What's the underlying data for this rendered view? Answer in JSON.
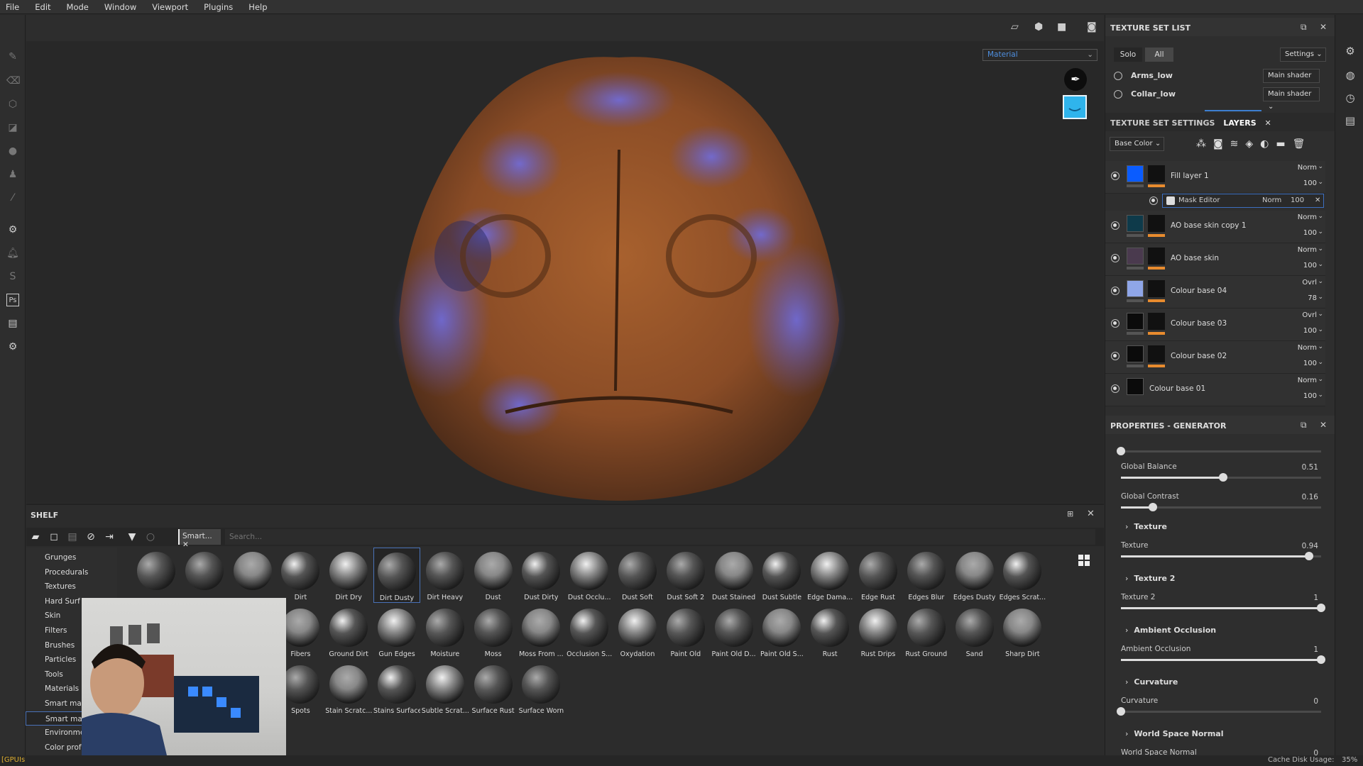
{
  "menu": [
    "File",
    "Edit",
    "Mode",
    "Window",
    "Viewport",
    "Plugins",
    "Help"
  ],
  "viewport": {
    "material_select": "Material",
    "icons": [
      "camera-perspective-icon",
      "environment-cube-icon",
      "video-camera-icon",
      "screenshot-camera-icon"
    ]
  },
  "shelf": {
    "title": "SHELF",
    "filter_tag": "Smart...",
    "search_placeholder": "Search...",
    "categories": [
      "Grunges",
      "Procedurals",
      "Textures",
      "Hard Surf",
      "Skin",
      "Filters",
      "Brushes",
      "Particles",
      "Tools",
      "Materials",
      "Smart mat",
      "Smart mas",
      "Environme",
      "Color prof"
    ],
    "selected_category": "Smart mas",
    "rows": [
      [
        "",
        "",
        "",
        "Dirt",
        "Dirt Dry",
        "Dirt Dusty",
        "Dirt Heavy",
        "Dust",
        "Dust Dirty",
        "Dust Occlu...",
        "Dust Soft",
        "Dust Soft 2",
        "Dust Stained",
        "Dust Subtle",
        "Edge Dama...",
        "Edge Rust",
        "Edges Blur",
        "Edges Dusty",
        "Edges Scrat..."
      ],
      [
        "Fibers",
        "Ground Dirt",
        "Gun Edges",
        "Moisture",
        "Moss",
        "Moss From ...",
        "Occlusion S...",
        "Oxydation",
        "Paint Old",
        "Paint Old D...",
        "Paint Old S...",
        "Rust",
        "Rust Drips",
        "Rust Ground",
        "Sand",
        "Sharp Dirt"
      ],
      [
        "Spots",
        "Stain Scratc...",
        "Stains Surface",
        "Subtle Scrat...",
        "Surface Rust",
        "Surface Worn"
      ]
    ],
    "selected_item": "Dirt Dusty"
  },
  "texture_set_list": {
    "title": "TEXTURE SET LIST",
    "solo": "Solo",
    "all": "All",
    "settings": "Settings",
    "sets": [
      {
        "name": "Arms_low",
        "shader": "Main shader"
      },
      {
        "name": "Collar_low",
        "shader": "Main shader"
      }
    ]
  },
  "layers_panel": {
    "tab_settings": "TEXTURE SET SETTINGS",
    "tab_layers": "LAYERS",
    "channel": "Base Color",
    "layers": [
      {
        "name": "Fill layer 1",
        "blend": "Norm",
        "opacity": "100",
        "color": "#0a5cff"
      },
      {
        "name": "AO base skin copy 1",
        "blend": "Norm",
        "opacity": "100",
        "color": "#0e3a4a"
      },
      {
        "name": "AO base skin",
        "blend": "Norm",
        "opacity": "100",
        "color": "#4a3a4e"
      },
      {
        "name": "Colour base 04",
        "blend": "Ovrl",
        "opacity": "78",
        "color": "#8fa6e8"
      },
      {
        "name": "Colour base 03",
        "blend": "Ovrl",
        "opacity": "100",
        "color": "#0b0b0b"
      },
      {
        "name": "Colour base 02",
        "blend": "Norm",
        "opacity": "100",
        "color": "#0b0b0b"
      },
      {
        "name": "Colour base 01",
        "blend": "Norm",
        "opacity": "100",
        "color": "#0b0b0b"
      }
    ],
    "mask": {
      "name": "Mask Editor",
      "blend": "Norm",
      "opacity": "100"
    }
  },
  "properties": {
    "title": "PROPERTIES - GENERATOR",
    "top_slider": 0,
    "items": [
      {
        "label": "Global Balance",
        "value": "0.51",
        "fraction": 0.51
      },
      {
        "label": "Global Contrast",
        "value": "0.16",
        "fraction": 0.16
      },
      {
        "section": "Texture",
        "label": "Texture",
        "value": "0.94",
        "fraction": 0.94
      },
      {
        "section": "Texture 2",
        "label": "Texture 2",
        "value": "1",
        "fraction": 1
      },
      {
        "section": "Ambient Occlusion",
        "label": "Ambient Occlusion",
        "value": "1",
        "fraction": 1
      },
      {
        "section": "Curvature",
        "label": "Curvature",
        "value": "0",
        "fraction": 0
      },
      {
        "section": "World Space Normal",
        "label": "World Space Normal",
        "value": "0"
      }
    ]
  },
  "status": {
    "left": "[GPUIs",
    "cache": "Cache Disk Usage:",
    "cache_value": "35%"
  },
  "colors": {
    "accent": "#4a72b8",
    "mask_bar": "#e88b2e",
    "viewport_blue": "#2fb4ec"
  }
}
